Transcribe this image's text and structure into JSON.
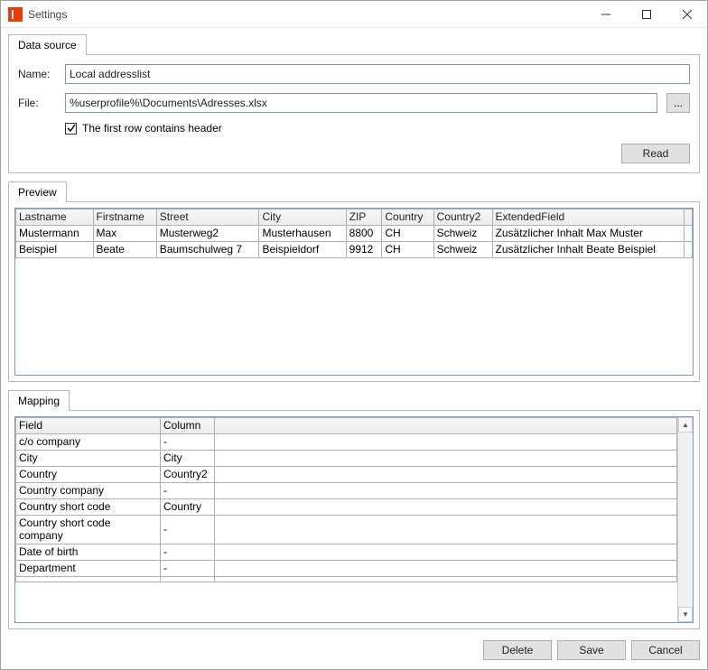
{
  "window": {
    "title": "Settings"
  },
  "datasource": {
    "tab_label": "Data source",
    "name_label": "Name:",
    "name_value": "Local addresslist",
    "file_label": "File:",
    "file_value": "%userprofile%\\Documents\\Adresses.xlsx",
    "browse_label": "...",
    "header_checkbox_label": "The first row contains header",
    "header_checked": true,
    "read_button": "Read"
  },
  "preview": {
    "tab_label": "Preview",
    "columns": [
      "Lastname",
      "Firstname",
      "Street",
      "City",
      "ZIP",
      "Country",
      "Country2",
      "ExtendedField"
    ],
    "rows": [
      [
        "Mustermann",
        "Max",
        "Musterweg2",
        "Musterhausen",
        "8800",
        "CH",
        "Schweiz",
        "Zusätzlicher Inhalt Max Muster"
      ],
      [
        "Beispiel",
        "Beate",
        "Baumschulweg 7",
        "Beispieldorf",
        "9912",
        "CH",
        "Schweiz",
        "Zusätzlicher Inhalt Beate Beispiel"
      ]
    ]
  },
  "mapping": {
    "tab_label": "Mapping",
    "columns": [
      "Field",
      "Column"
    ],
    "rows": [
      {
        "field": "c/o company",
        "column": "-"
      },
      {
        "field": "City",
        "column": "City"
      },
      {
        "field": "Country",
        "column": "Country2"
      },
      {
        "field": "Country company",
        "column": "-"
      },
      {
        "field": "Country short code",
        "column": "Country"
      },
      {
        "field": "Country short code company",
        "column": "-"
      },
      {
        "field": "Date of birth",
        "column": "-"
      },
      {
        "field": "Department",
        "column": "-"
      }
    ]
  },
  "footer": {
    "delete": "Delete",
    "save": "Save",
    "cancel": "Cancel"
  }
}
